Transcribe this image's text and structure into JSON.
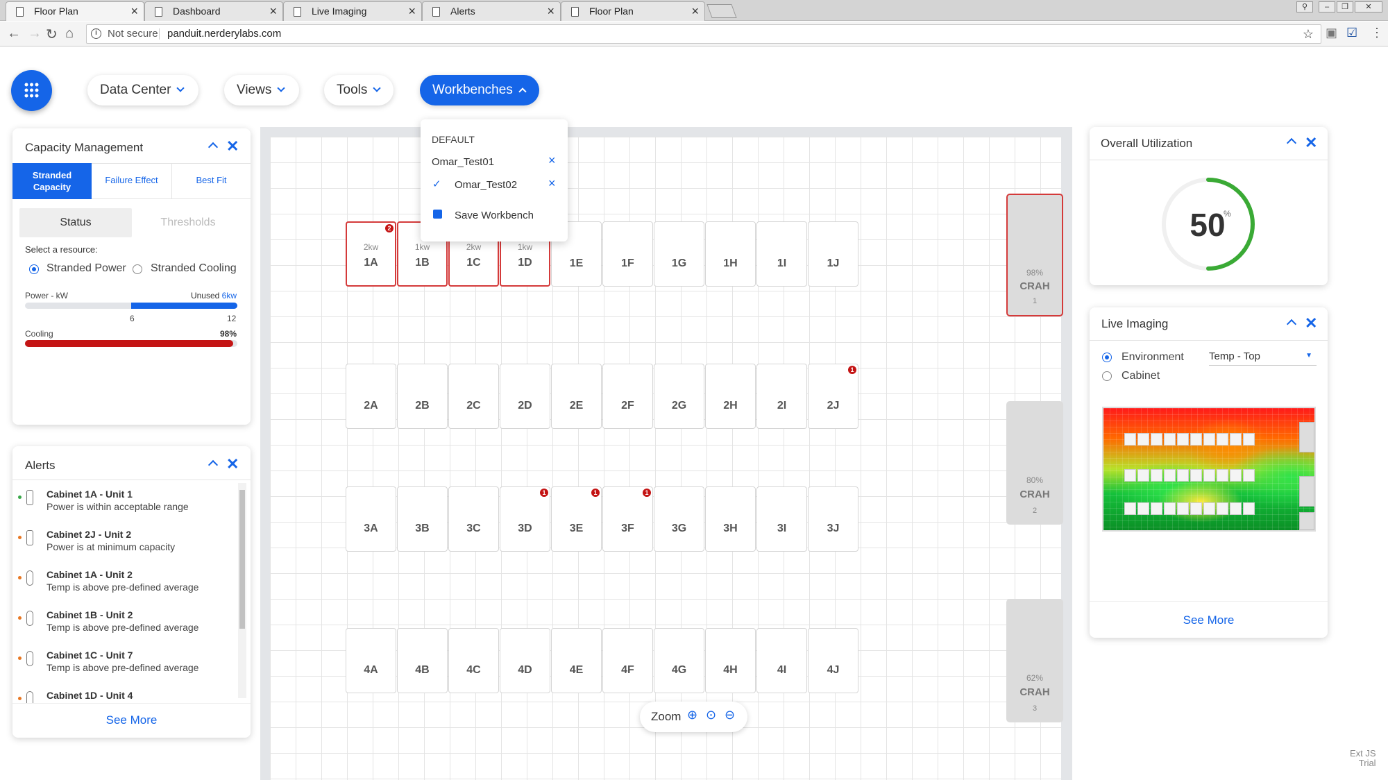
{
  "browser": {
    "tabs": [
      {
        "title": "Floor Plan",
        "active": true
      },
      {
        "title": "Dashboard"
      },
      {
        "title": "Live Imaging"
      },
      {
        "title": "Alerts"
      },
      {
        "title": "Floor Plan"
      }
    ],
    "not_secure": "Not secure",
    "url": "panduit.nerderylabs.com"
  },
  "nav": {
    "data_center": "Data Center",
    "views": "Views",
    "tools": "Tools",
    "workbenches": "Workbenches"
  },
  "workbench_menu": {
    "header": "DEFAULT",
    "items": [
      "Omar_Test01",
      "Omar_Test02"
    ],
    "selected": "Omar_Test02",
    "save": "Save Workbench"
  },
  "capacity": {
    "title": "Capacity Management",
    "tabs": [
      "Stranded Capacity",
      "Failure Effect",
      "Best Fit"
    ],
    "subtabs": [
      "Status",
      "Thresholds"
    ],
    "select_label": "Select a resource:",
    "radio_power": "Stranded Power",
    "radio_cooling": "Stranded Cooling",
    "power_label": "Power - kW",
    "unused_label": "Unused",
    "unused_value": "6kw",
    "power_fraction_used": 0.5,
    "tick_mid": "6",
    "tick_max": "12",
    "cooling_label": "Cooling",
    "cooling_value": "98%",
    "cooling_fraction": 0.98
  },
  "alerts": {
    "title": "Alerts",
    "items": [
      {
        "title": "Cabinet 1A - Unit 1",
        "desc": "Power is within acceptable range",
        "status": "#3aa84a",
        "icon": "battery-icon"
      },
      {
        "title": "Cabinet 2J - Unit 2",
        "desc": "Power is at minimum capacity",
        "status": "#e87722",
        "icon": "battery-icon"
      },
      {
        "title": "Cabinet 1A - Unit 2",
        "desc": "Temp is above pre-defined average",
        "status": "#e87722",
        "icon": "thermometer-icon"
      },
      {
        "title": "Cabinet 1B - Unit 2",
        "desc": "Temp is above pre-defined average",
        "status": "#e87722",
        "icon": "thermometer-icon"
      },
      {
        "title": "Cabinet 1C - Unit 7",
        "desc": "Temp is above pre-defined average",
        "status": "#e87722",
        "icon": "thermometer-icon"
      },
      {
        "title": "Cabinet 1D - Unit 4",
        "desc": "",
        "status": "#e87722",
        "icon": "thermometer-icon"
      }
    ],
    "see_more": "See More"
  },
  "floor": {
    "rows": [
      [
        "1A",
        "1B",
        "1C",
        "1D",
        "1E",
        "1F",
        "1G",
        "1H",
        "1I",
        "1J"
      ],
      [
        "2A",
        "2B",
        "2C",
        "2D",
        "2E",
        "2F",
        "2G",
        "2H",
        "2I",
        "2J"
      ],
      [
        "3A",
        "3B",
        "3C",
        "3D",
        "3E",
        "3F",
        "3G",
        "3H",
        "3I",
        "3J"
      ],
      [
        "4A",
        "4B",
        "4C",
        "4D",
        "4E",
        "4F",
        "4G",
        "4H",
        "4I",
        "4J"
      ]
    ],
    "power_labels": {
      "1A": "2kw",
      "1B": "1kw",
      "1C": "2kw",
      "1D": "1kw"
    },
    "highlighted": [
      "1A",
      "1B",
      "1C",
      "1D"
    ],
    "badges": {
      "1A": "2",
      "2J": "1",
      "3D": "1",
      "3E": "1",
      "3F": "1"
    },
    "crah": [
      {
        "pct": "98%",
        "label": "CRAH",
        "num": "1",
        "alarm": true
      },
      {
        "pct": "80%",
        "label": "CRAH",
        "num": "2"
      },
      {
        "pct": "62%",
        "label": "CRAH",
        "num": "3"
      }
    ],
    "zoom_label": "Zoom"
  },
  "utilization": {
    "title": "Overall Utilization",
    "value": "50",
    "unit": "%",
    "fraction": 0.5
  },
  "live_imaging": {
    "title": "Live Imaging",
    "radio_environment": "Environment",
    "radio_cabinet": "Cabinet",
    "select_value": "Temp - Top",
    "see_more": "See More"
  },
  "watermark": {
    "line1": "Ext JS",
    "line2": "Trial"
  },
  "colors": {
    "accent": "#1565e8",
    "alarm": "#c41414",
    "cooling": "#c41414",
    "gauge": "#3aaa35"
  }
}
